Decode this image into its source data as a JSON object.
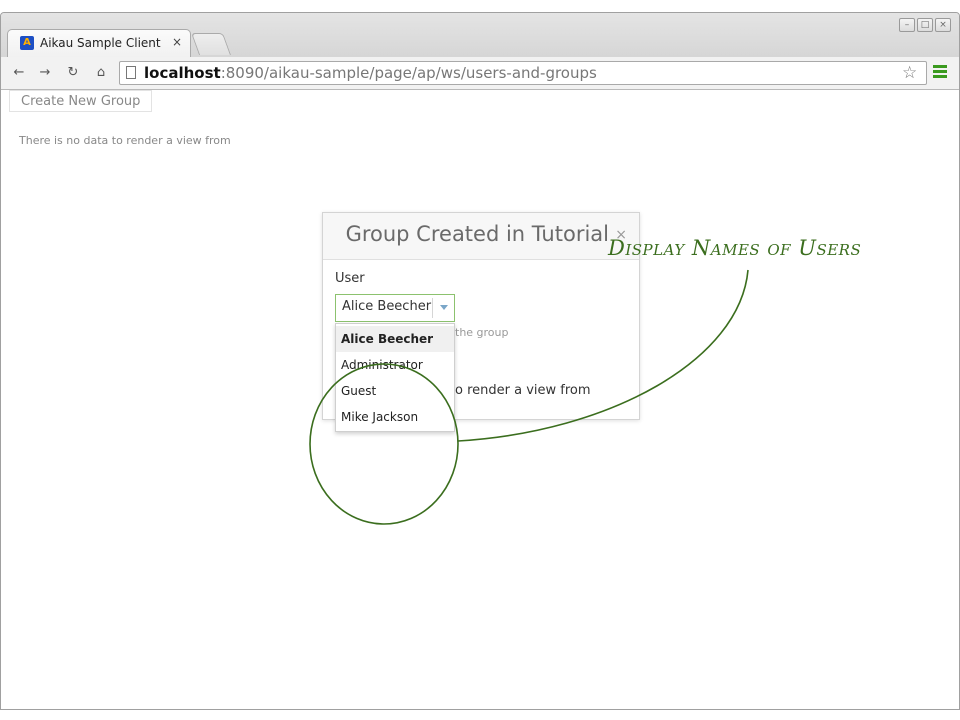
{
  "browser": {
    "tab_title": "Aikau Sample Client",
    "tab_close": "×",
    "favicon_letter": "A",
    "url_host": "localhost",
    "url_rest": ":8090/aikau-sample/page/ap/ws/users-and-groups",
    "icons": {
      "back": "back-arrow-icon",
      "forward": "forward-arrow-icon",
      "reload": "reload-icon",
      "home": "home-icon",
      "page": "page-icon",
      "bookmark": "star-icon",
      "menu": "hamburger-menu-icon"
    },
    "accent_color": "#3a9a1e"
  },
  "page": {
    "create_group_button": "Create New Group",
    "empty_message": "There is no data to render a view from"
  },
  "dialog": {
    "title": "Group Created in Tutorial",
    "close": "×",
    "user_label": "User",
    "selected_user": "Alice Beecher",
    "help_text_visible": "the group",
    "message_visible": "o render a view from",
    "select_border_color": "#8cc26e"
  },
  "dropdown": {
    "options": [
      {
        "label": "Alice Beecher",
        "selected": true
      },
      {
        "label": "Administrator",
        "selected": false
      },
      {
        "label": "Guest",
        "selected": false
      },
      {
        "label": "Mike Jackson",
        "selected": false
      }
    ]
  },
  "annotation": {
    "text": "Display Names of Users",
    "color": "#3b6e1e"
  }
}
